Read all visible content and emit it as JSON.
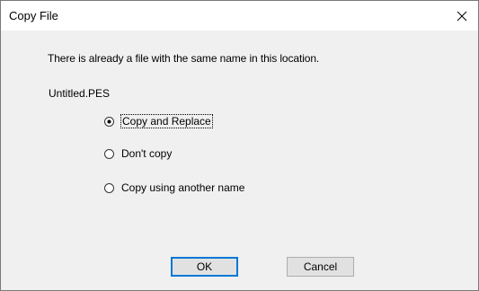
{
  "window": {
    "title": "Copy File",
    "close_icon": "close-icon"
  },
  "message": "There is already a file with the same name in this location.",
  "filename": "Untitled.PES",
  "options": [
    {
      "label": "Copy and Replace",
      "selected": true
    },
    {
      "label": "Don't copy",
      "selected": false
    },
    {
      "label": "Copy using another name",
      "selected": false
    }
  ],
  "buttons": {
    "ok_label": "OK",
    "cancel_label": "Cancel"
  },
  "colors": {
    "title_bar": "#ffffff",
    "client_bg": "#f0f0f0",
    "button_bg": "#e1e1e1",
    "default_button_border": "#0078d7"
  }
}
